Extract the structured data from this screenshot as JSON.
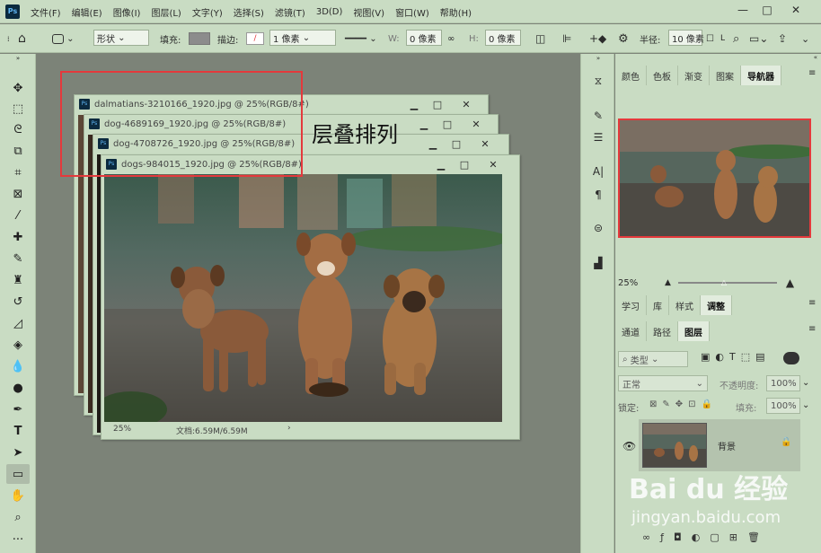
{
  "menubar": {
    "logo": "Ps",
    "items": [
      "文件(F)",
      "编辑(E)",
      "图像(I)",
      "图层(L)",
      "文字(Y)",
      "选择(S)",
      "滤镜(T)",
      "3D(D)",
      "视图(V)",
      "窗口(W)",
      "帮助(H)"
    ],
    "win_min": "—",
    "win_max": "□",
    "win_close": "✕"
  },
  "options": {
    "shape_mode": "形状",
    "fill_label": "填充:",
    "stroke_label": "描边:",
    "stroke_size": "1 像素",
    "w_label": "W:",
    "w_value": "0 像素",
    "h_label": "H:",
    "h_value": "0 像素",
    "radius_label": "半径:",
    "radius_value": "10 像素"
  },
  "documents": [
    {
      "title": "dalmatians-3210166_1920.jpg @ 25%(RGB/8#)"
    },
    {
      "title": "dog-4689169_1920.jpg @ 25%(RGB/8#)"
    },
    {
      "title": "dog-4708726_1920.jpg @ 25%(RGB/8#)"
    },
    {
      "title": "dogs-984015_1920.jpg @ 25%(RGB/8#)"
    }
  ],
  "doc_controls": {
    "min": "▁",
    "max": "□",
    "close": "✕"
  },
  "status": {
    "zoom": "25%",
    "doc_info": "文档:6.59M/6.59M",
    "arrow": "›"
  },
  "annotation": "层叠排列",
  "panel_top": {
    "tabs": [
      "颜色",
      "色板",
      "渐变",
      "图案",
      "导航器"
    ],
    "active": "导航器",
    "zoom": "25%"
  },
  "panel_mid": {
    "tabs": [
      "学习",
      "库",
      "样式",
      "调整"
    ],
    "active": "调整"
  },
  "panel_layers": {
    "tabs": [
      "通道",
      "路径",
      "图层"
    ],
    "active": "图层",
    "kind": "类型",
    "blend": "正常",
    "opacity_label": "不透明度:",
    "opacity": "100%",
    "lock_label": "锁定:",
    "fill_label": "填充:",
    "fill": "100%",
    "layer_name": "背景"
  },
  "watermark": {
    "brand": "Bai du 经验",
    "url": "jingyan.baidu.com"
  },
  "colors": {
    "ui": "#c9dcc3",
    "canvas": "#7c8378",
    "highlight": "#e4393c"
  }
}
